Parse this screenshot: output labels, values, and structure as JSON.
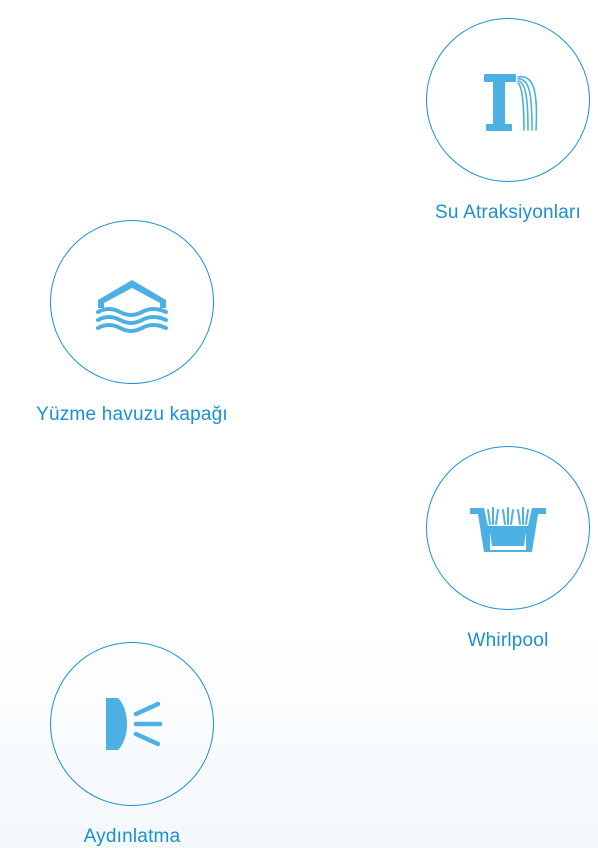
{
  "colors": {
    "accent": "#1b8fd2",
    "icon": "#4cb0e4",
    "background": "#ffffff",
    "background_tint": "#f3f8fc"
  },
  "features": {
    "water": {
      "label": "Su Atraksiyonları",
      "icon": "water-fountain-icon"
    },
    "cover": {
      "label": "Yüzme havuzu kapağı",
      "icon": "pool-cover-icon"
    },
    "whirlpool": {
      "label": "Whirlpool",
      "icon": "whirlpool-icon"
    },
    "lighting": {
      "label": "Aydınlatma",
      "icon": "pool-light-icon"
    }
  }
}
